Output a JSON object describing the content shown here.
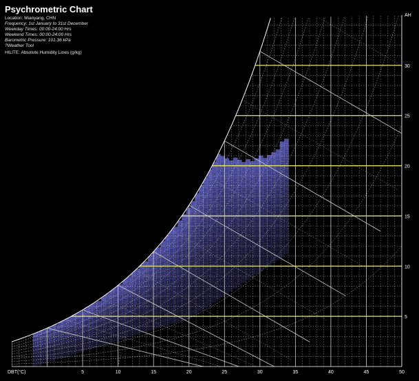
{
  "header": {
    "title": "Psychrometric Chart",
    "lines": [
      "Location: Mianyang, CHN",
      "Frequency: 1st January to 31st December",
      "Weekday Times: 00:00-24:00 Hrs",
      "Weekend Times: 00:00-24:00 Hrs",
      "Barometric Pressure: 101.36 kPa",
      "?Weather Tool"
    ],
    "hilite": "HILITE: Absolute Humidity Lines (g/kg)"
  },
  "chart_data": {
    "type": "heatmap",
    "title": "Psychrometric Chart",
    "xlabel": "DBT(°C)",
    "ylabel": "AH",
    "x_ticks": [
      5,
      10,
      15,
      20,
      25,
      30,
      35,
      40,
      45,
      50
    ],
    "y_ticks": [
      5,
      10,
      15,
      20,
      25,
      30
    ],
    "xlim": [
      -5,
      50
    ],
    "ylim": [
      0,
      35
    ],
    "highlight_lines": [
      5,
      10,
      15,
      20,
      25,
      30
    ],
    "colors": {
      "saturation": "#ffffff",
      "grid": "#cfcfcf",
      "hilite": "#e8e86a",
      "density": "#7070e0"
    }
  }
}
